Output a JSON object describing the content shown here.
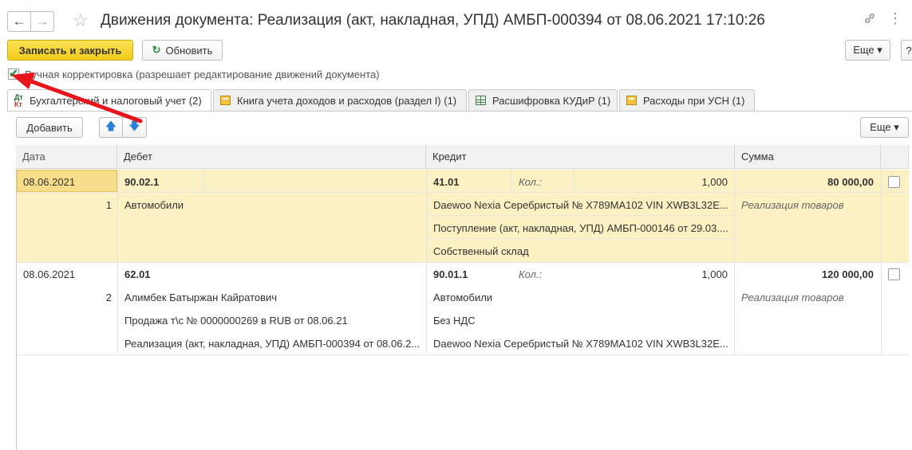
{
  "window": {
    "title": "Движения документа: Реализация (акт, накладная, УПД) АМБП-000394 от 08.06.2021 17:10:26",
    "back_icon": "←",
    "forward_icon": "→",
    "star_icon": "☆",
    "link_icon": "🔗",
    "menu_icon": "⋮"
  },
  "toolbar": {
    "save_close": "Записать и закрыть",
    "refresh": "Обновить",
    "refresh_icon": "↻",
    "more": "Еще ▾",
    "more2": "?"
  },
  "manual": {
    "checked": true,
    "check_mark": "✔",
    "label": "Ручная корректировка (разрешает редактирование движений документа)"
  },
  "tabs": [
    {
      "label": "Бухгалтерский и налоговый учет (2)",
      "icon_dt": "Дт",
      "icon_kt": "Кт"
    },
    {
      "label": "Книга учета доходов и расходов (раздел I) (1)"
    },
    {
      "label": "Расшифровка КУДиР (1)"
    },
    {
      "label": "Расходы при УСН (1)"
    }
  ],
  "grid_toolbar": {
    "add": "Добавить",
    "up_icon": "🡅",
    "down_icon": "🡇",
    "more": "Еще ▾"
  },
  "table": {
    "columns": [
      "Дата",
      "Дебет",
      "Кредит",
      "Сумма"
    ],
    "rows": [
      {
        "date": "08.06.2021",
        "num": "1",
        "debet": "90.02.1",
        "debet_sub": [
          "Автомобили"
        ],
        "kredit": "41.01",
        "qty_label": "Кол.:",
        "qty": "1,000",
        "kredit_sub": [
          "Daewoo Nexia Серебристый № Х789МА102 VIN XWB3L32E...",
          "Поступление (акт, накладная, УПД) АМБП-000146 от 29.03....",
          "Собственный склад"
        ],
        "sum": "80 000,00",
        "sum_sub": "Реализация товаров"
      },
      {
        "date": "08.06.2021",
        "num": "2",
        "debet": "62.01",
        "debet_sub": [
          "Алимбек Батыржан Кайратович",
          "Продажа т\\с № 0000000269 в RUB от 08.06.21",
          "Реализация (акт, накладная, УПД) АМБП-000394 от 08.06.2..."
        ],
        "kredit": "90.01.1",
        "qty_label": "Кол.:",
        "qty": "1,000",
        "kredit_sub": [
          "Автомобили",
          "Без НДС",
          "Daewoo Nexia Серебристый № Х789МА102 VIN XWB3L32E..."
        ],
        "sum": "120 000,00",
        "sum_sub": "Реализация товаров"
      }
    ]
  },
  "colors": {
    "accent_yellow": "#f2cc1d",
    "selected_row": "#fbf1c3",
    "annotation_arrow": "#e8141b"
  }
}
